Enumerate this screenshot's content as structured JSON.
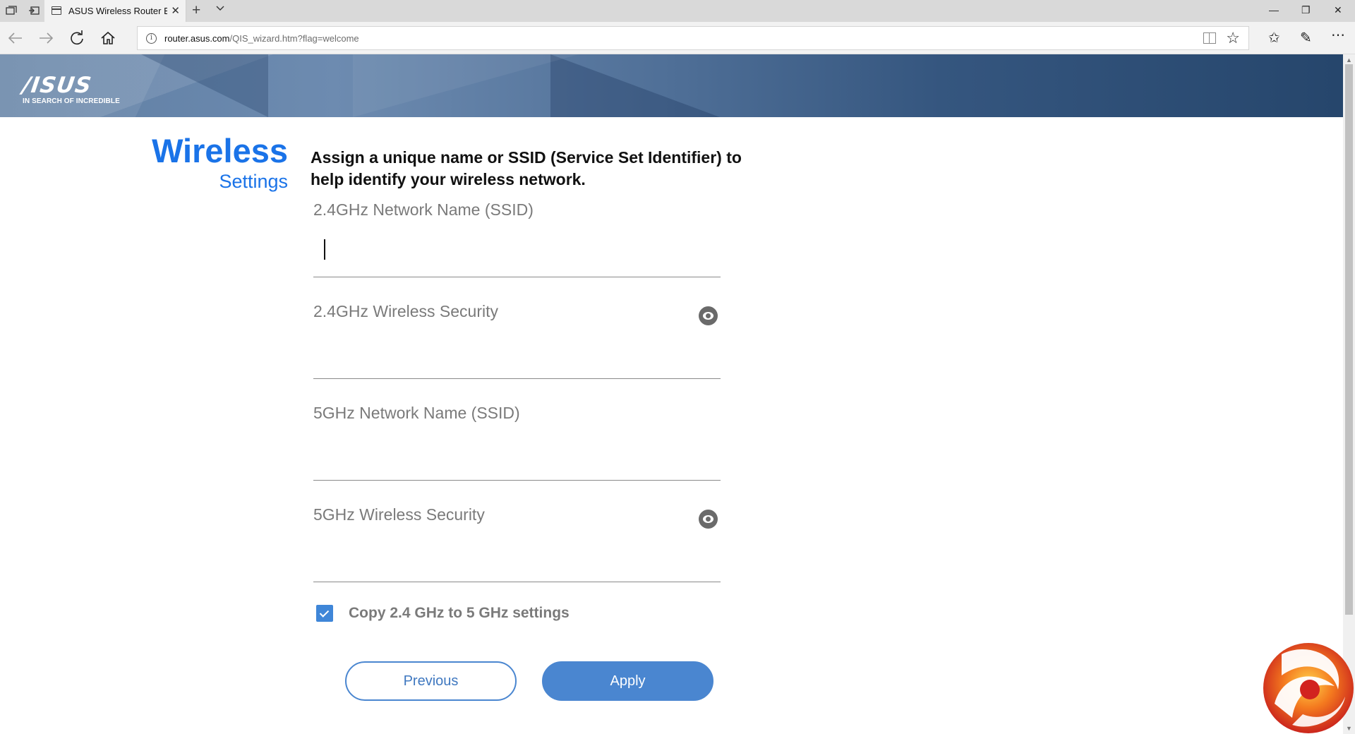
{
  "browser": {
    "tab_title": "ASUS Wireless Router B",
    "url_host": "router.asus.com",
    "url_path": "/QIS_wizard.htm?flag=welcome"
  },
  "banner": {
    "logo_text": "/ISUS",
    "tagline": "IN SEARCH OF INCREDIBLE"
  },
  "wizard": {
    "title": "Wireless",
    "subtitle": "Settings",
    "description": "Assign a unique name or SSID (Service Set Identifier) to help identify your wireless network.",
    "fields": [
      {
        "label": "2.4GHz Network Name (SSID)",
        "value": "",
        "has_eye": false
      },
      {
        "label": "2.4GHz Wireless Security",
        "value": "",
        "has_eye": true
      },
      {
        "label": "5GHz Network Name (SSID)",
        "value": "",
        "has_eye": false
      },
      {
        "label": "5GHz Wireless Security",
        "value": "",
        "has_eye": true
      }
    ],
    "copy_checkbox": {
      "label": "Copy 2.4 GHz to 5 GHz settings",
      "checked": true
    },
    "buttons": {
      "previous": "Previous",
      "apply": "Apply"
    }
  },
  "colors": {
    "accent": "#1a73e8",
    "button_blue": "#4a86d0",
    "label_gray": "#7a7a7a"
  },
  "icons": {
    "password_toggle": "eye-icon",
    "checkbox": "checkmark-icon"
  }
}
